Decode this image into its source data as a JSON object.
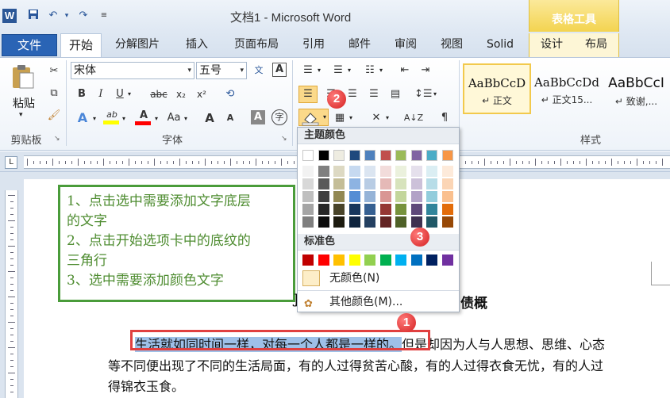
{
  "title_bar": {
    "app_icon": "W",
    "doc_title": "文档1 - Microsoft Word",
    "context_group": "表格工具",
    "qa_arrow": "▾"
  },
  "tabs": {
    "file": "文件",
    "home": "开始",
    "others": [
      "分解图片",
      "插入",
      "页面布局",
      "引用",
      "邮件",
      "审阅",
      "视图",
      "Solid"
    ],
    "design": "设计",
    "layout": "布局"
  },
  "ribbon": {
    "clipboard": {
      "paste": "粘贴",
      "group": "剪贴板"
    },
    "font": {
      "name": "宋体",
      "size": "五号",
      "group": "字体",
      "bold": "B",
      "italic": "I",
      "underline": "U",
      "strike": "abc",
      "sub": "x₂",
      "sup": "x²",
      "effects": "A",
      "aa": "Aa",
      "grow": "A",
      "shrink": "A",
      "clear": "A",
      "encircle": "字",
      "wen": "文",
      "phonetic": "A"
    },
    "paragraph": {
      "sort": "A↓Z"
    },
    "styles": {
      "group": "样式",
      "items": [
        {
          "sample": "AaBbCcD",
          "name": "↵ 正文"
        },
        {
          "sample": "AaBbCcDd",
          "name": "↵ 正文15..."
        },
        {
          "sample": "AaBbCcI",
          "name": "↵ 致谢,..."
        }
      ]
    }
  },
  "color_palette": {
    "theme_label": "主题颜色",
    "theme_top": [
      "#ffffff",
      "#000000",
      "#eeece1",
      "#1f497d",
      "#4f81bd",
      "#c0504d",
      "#9bbb59",
      "#8064a2",
      "#4bacc6",
      "#f79646"
    ],
    "theme_shades": [
      [
        "#f2f2f2",
        "#7f7f7f",
        "#ddd9c3",
        "#c6d9f0",
        "#dbe5f1",
        "#f2dcdb",
        "#ebf1dd",
        "#e5e0ec",
        "#dbeef3",
        "#fdeada"
      ],
      [
        "#d8d8d8",
        "#595959",
        "#c4bd97",
        "#8db3e2",
        "#b8cce4",
        "#e5b9b7",
        "#d7e3bc",
        "#ccc1d9",
        "#b7dde8",
        "#fbd5b5"
      ],
      [
        "#bfbfbf",
        "#3f3f3f",
        "#938953",
        "#548dd4",
        "#95b3d7",
        "#d99694",
        "#c3d69b",
        "#b2a2c7",
        "#92cddc",
        "#fac08f"
      ],
      [
        "#a5a5a5",
        "#262626",
        "#494429",
        "#17365d",
        "#366092",
        "#953734",
        "#76923c",
        "#5f497a",
        "#31859b",
        "#e36c09"
      ],
      [
        "#7f7f7f",
        "#0c0c0c",
        "#1d1b10",
        "#0f243e",
        "#244061",
        "#632423",
        "#4f6128",
        "#3f3151",
        "#205867",
        "#974806"
      ]
    ],
    "standard_label": "标准色",
    "standard": [
      "#c00000",
      "#ff0000",
      "#ffc000",
      "#ffff00",
      "#92d050",
      "#00b050",
      "#00b0f0",
      "#0070c0",
      "#002060",
      "#7030a0"
    ],
    "no_color": "无颜色(N)",
    "more_colors": "其他颜色(M)..."
  },
  "note": {
    "lines": [
      "1、点击选中需要添加文字底层",
      "的文字",
      "2、点击开始选项卡中的底纹的",
      "三角行",
      "3、选中需要添加颜色文字"
    ]
  },
  "document": {
    "heading_partial": "债概",
    "para_selected": "生活就如同时间一样，对每一个人都是一样的。",
    "para_rest": "但是却因为人与人思想、思维、心态",
    "line2": "等不同便出现了不同的生活局面，有的人过得贫苦心酸，有的人过得衣食无忧，有的人过",
    "line3": "得锦衣玉食。",
    "heading_prefix": "J"
  },
  "badges": {
    "one": "1",
    "two": "2",
    "three": "3"
  }
}
